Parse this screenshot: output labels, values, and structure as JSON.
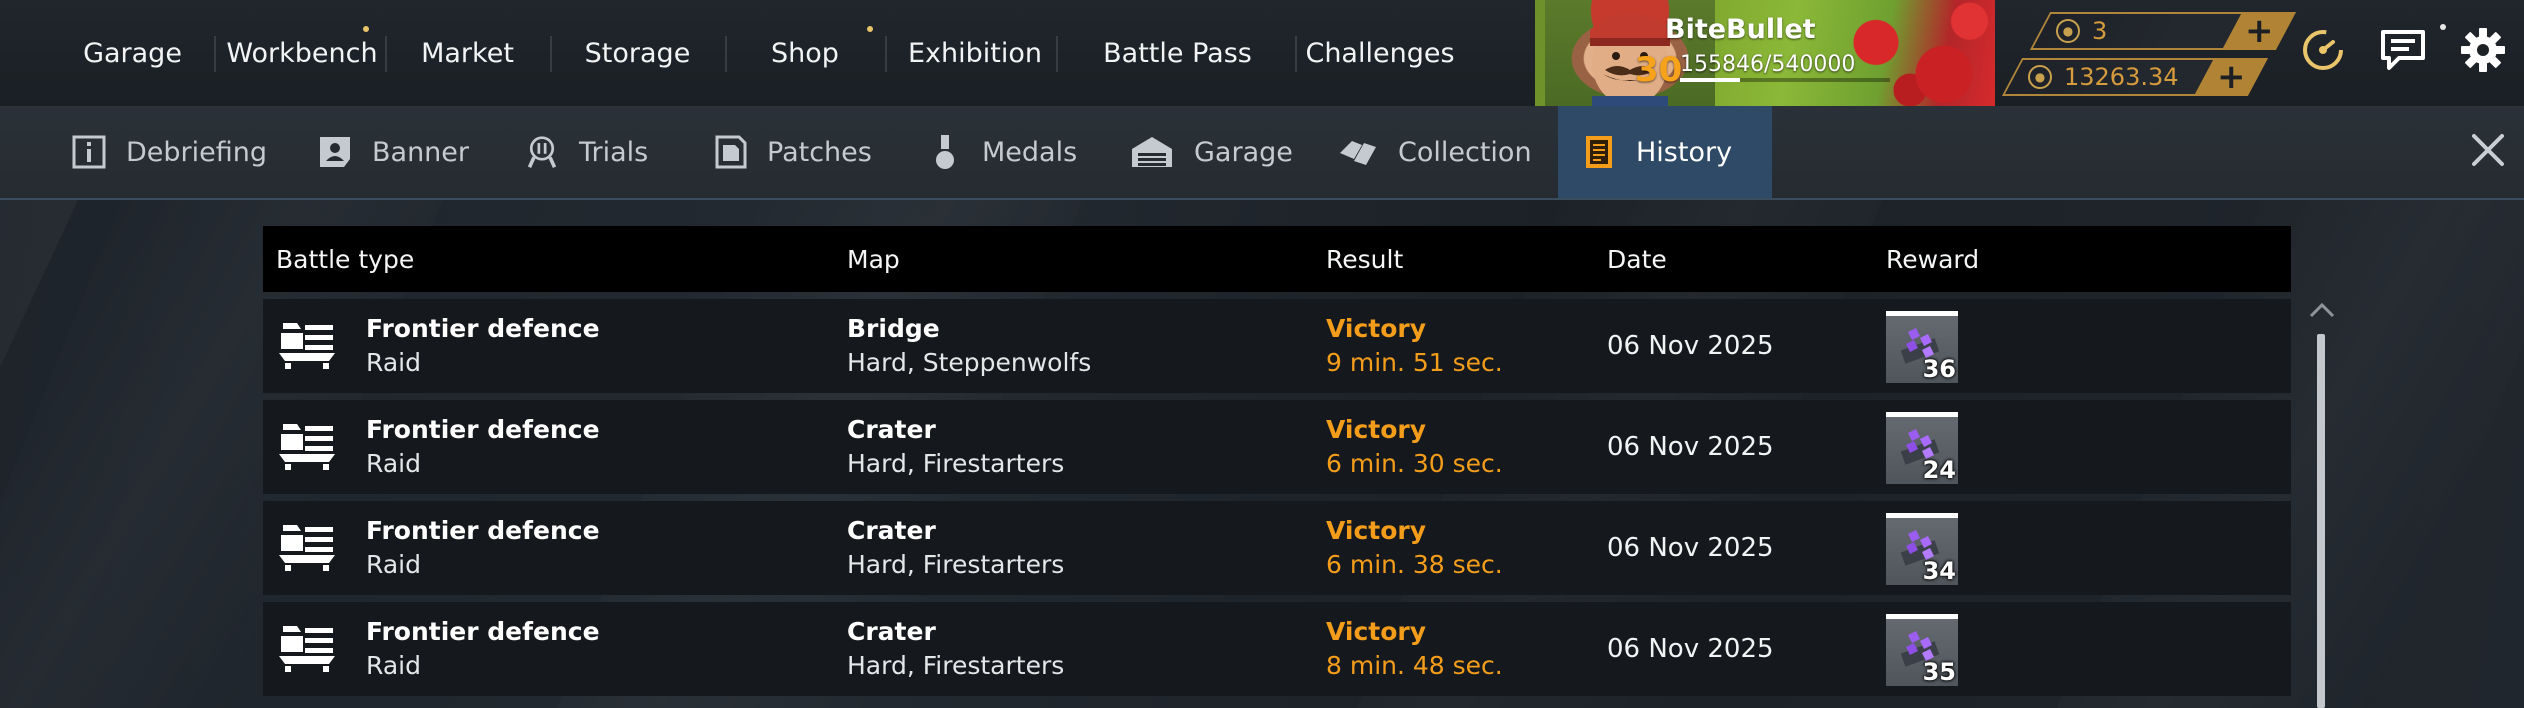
{
  "nav": {
    "items": [
      "Garage",
      "Workbench",
      "Market",
      "Storage",
      "Shop",
      "Exhibition",
      "Battle Pass",
      "Challenges"
    ]
  },
  "player": {
    "name": "BiteBullet",
    "level": "30",
    "xp": "155846/540000",
    "xp_fraction": 0.288
  },
  "currency": {
    "coupons": "3",
    "coins": "13263.34"
  },
  "icons": {
    "speed": "speedometer-icon",
    "chat": "chat-icon",
    "settings": "gear-icon",
    "close": "close-icon"
  },
  "tabs": [
    {
      "label": "Debriefing",
      "icon": "info-icon"
    },
    {
      "label": "Banner",
      "icon": "banner-icon"
    },
    {
      "label": "Trials",
      "icon": "trials-icon"
    },
    {
      "label": "Patches",
      "icon": "patch-icon"
    },
    {
      "label": "Medals",
      "icon": "medal-icon"
    },
    {
      "label": "Garage",
      "icon": "garage-icon"
    },
    {
      "label": "Collection",
      "icon": "collection-icon"
    },
    {
      "label": "History",
      "icon": "history-icon",
      "active": true
    }
  ],
  "table": {
    "headers": {
      "battle_type": "Battle type",
      "map": "Map",
      "result": "Result",
      "date": "Date",
      "reward": "Reward"
    },
    "rows": [
      {
        "mode": "Frontier defence",
        "sub": "Raid",
        "map": "Bridge",
        "map_detail": "Hard, Steppenwolfs",
        "result": "Victory",
        "duration": "9 min. 51 sec.",
        "date": "06 Nov 2025",
        "reward": "36"
      },
      {
        "mode": "Frontier defence",
        "sub": "Raid",
        "map": "Crater",
        "map_detail": "Hard, Firestarters",
        "result": "Victory",
        "duration": "6 min. 30 sec.",
        "date": "06 Nov 2025",
        "reward": "24"
      },
      {
        "mode": "Frontier defence",
        "sub": "Raid",
        "map": "Crater",
        "map_detail": "Hard, Firestarters",
        "result": "Victory",
        "duration": "6 min. 38 sec.",
        "date": "06 Nov 2025",
        "reward": "34"
      },
      {
        "mode": "Frontier defence",
        "sub": "Raid",
        "map": "Crater",
        "map_detail": "Hard, Firestarters",
        "result": "Victory",
        "duration": "8 min. 48 sec.",
        "date": "06 Nov 2025",
        "reward": "35"
      }
    ]
  },
  "colors": {
    "accent": "#f49d1b",
    "active_tab": "#2f4a66",
    "currency_border": "#b0863a"
  }
}
